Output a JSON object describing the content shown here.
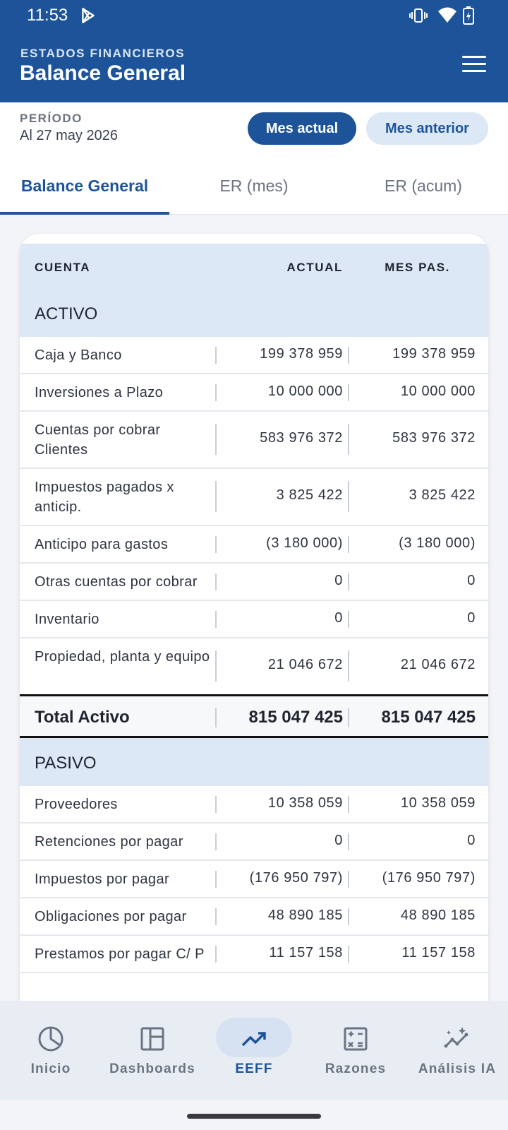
{
  "status_bar": {
    "time": "11:53"
  },
  "header": {
    "subtitle": "ESTADOS FINANCIEROS",
    "title": "Balance General"
  },
  "period": {
    "label": "PERÍODO",
    "value": "Al 27 may 2026",
    "current_button": "Mes actual",
    "previous_button": "Mes anterior"
  },
  "tabs": [
    {
      "label": "Balance General",
      "active": true
    },
    {
      "label": "ER (mes)",
      "active": false
    },
    {
      "label": "ER (acum)",
      "active": false
    }
  ],
  "table": {
    "columns": [
      "CUENTA",
      "ACTUAL",
      "MES PAS."
    ],
    "activo_title": "ACTIVO",
    "activo_rows": [
      {
        "cuenta": "Caja y Banco",
        "actual": "199 378 959",
        "mes_pas": "199 378 959"
      },
      {
        "cuenta": "Inversiones a Plazo",
        "actual": "10 000 000",
        "mes_pas": "10 000 000"
      },
      {
        "cuenta": "Cuentas por cobrar Clientes",
        "actual": "583 976 372",
        "mes_pas": "583 976 372"
      },
      {
        "cuenta": "Impuestos pagados x anticip.",
        "actual": "3 825 422",
        "mes_pas": "3 825 422"
      },
      {
        "cuenta": "Anticipo para gastos",
        "actual": "(3 180 000)",
        "mes_pas": "(3 180 000)"
      },
      {
        "cuenta": "Otras cuentas por cobrar",
        "actual": "0",
        "mes_pas": "0"
      },
      {
        "cuenta": "Inventario",
        "actual": "0",
        "mes_pas": "0"
      },
      {
        "cuenta": "Propiedad, planta y equipo",
        "actual": "21 046 672",
        "mes_pas": "21 046 672"
      }
    ],
    "total_activo": {
      "cuenta": "Total Activo",
      "actual": "815 047 425",
      "mes_pas": "815 047 425"
    },
    "pasivo_title": "PASIVO",
    "pasivo_rows": [
      {
        "cuenta": "Proveedores",
        "actual": "10 358 059",
        "mes_pas": "10 358 059"
      },
      {
        "cuenta": "Retenciones por pagar",
        "actual": "0",
        "mes_pas": "0"
      },
      {
        "cuenta": "Impuestos por pagar",
        "actual": "(176 950 797)",
        "mes_pas": "(176 950 797)"
      },
      {
        "cuenta": "Obligaciones por pagar",
        "actual": "48 890 185",
        "mes_pas": "48 890 185"
      },
      {
        "cuenta": "Prestamos por pagar C/ P",
        "actual": "11 157 158",
        "mes_pas": "11 157 158"
      }
    ]
  },
  "bottom_nav": [
    {
      "label": "Inicio",
      "icon": "pie-chart-icon",
      "active": false
    },
    {
      "label": "Dashboards",
      "icon": "dashboard-layout-icon",
      "active": false
    },
    {
      "label": "EEFF",
      "icon": "trending-up-icon",
      "active": true
    },
    {
      "label": "Razones",
      "icon": "calculator-icon",
      "active": false
    },
    {
      "label": "Análisis IA",
      "icon": "sparkle-chart-icon",
      "active": false
    }
  ],
  "colors": {
    "primary": "#1d5499",
    "light": "#dce8f6",
    "nav_bg": "#e8edf4"
  }
}
